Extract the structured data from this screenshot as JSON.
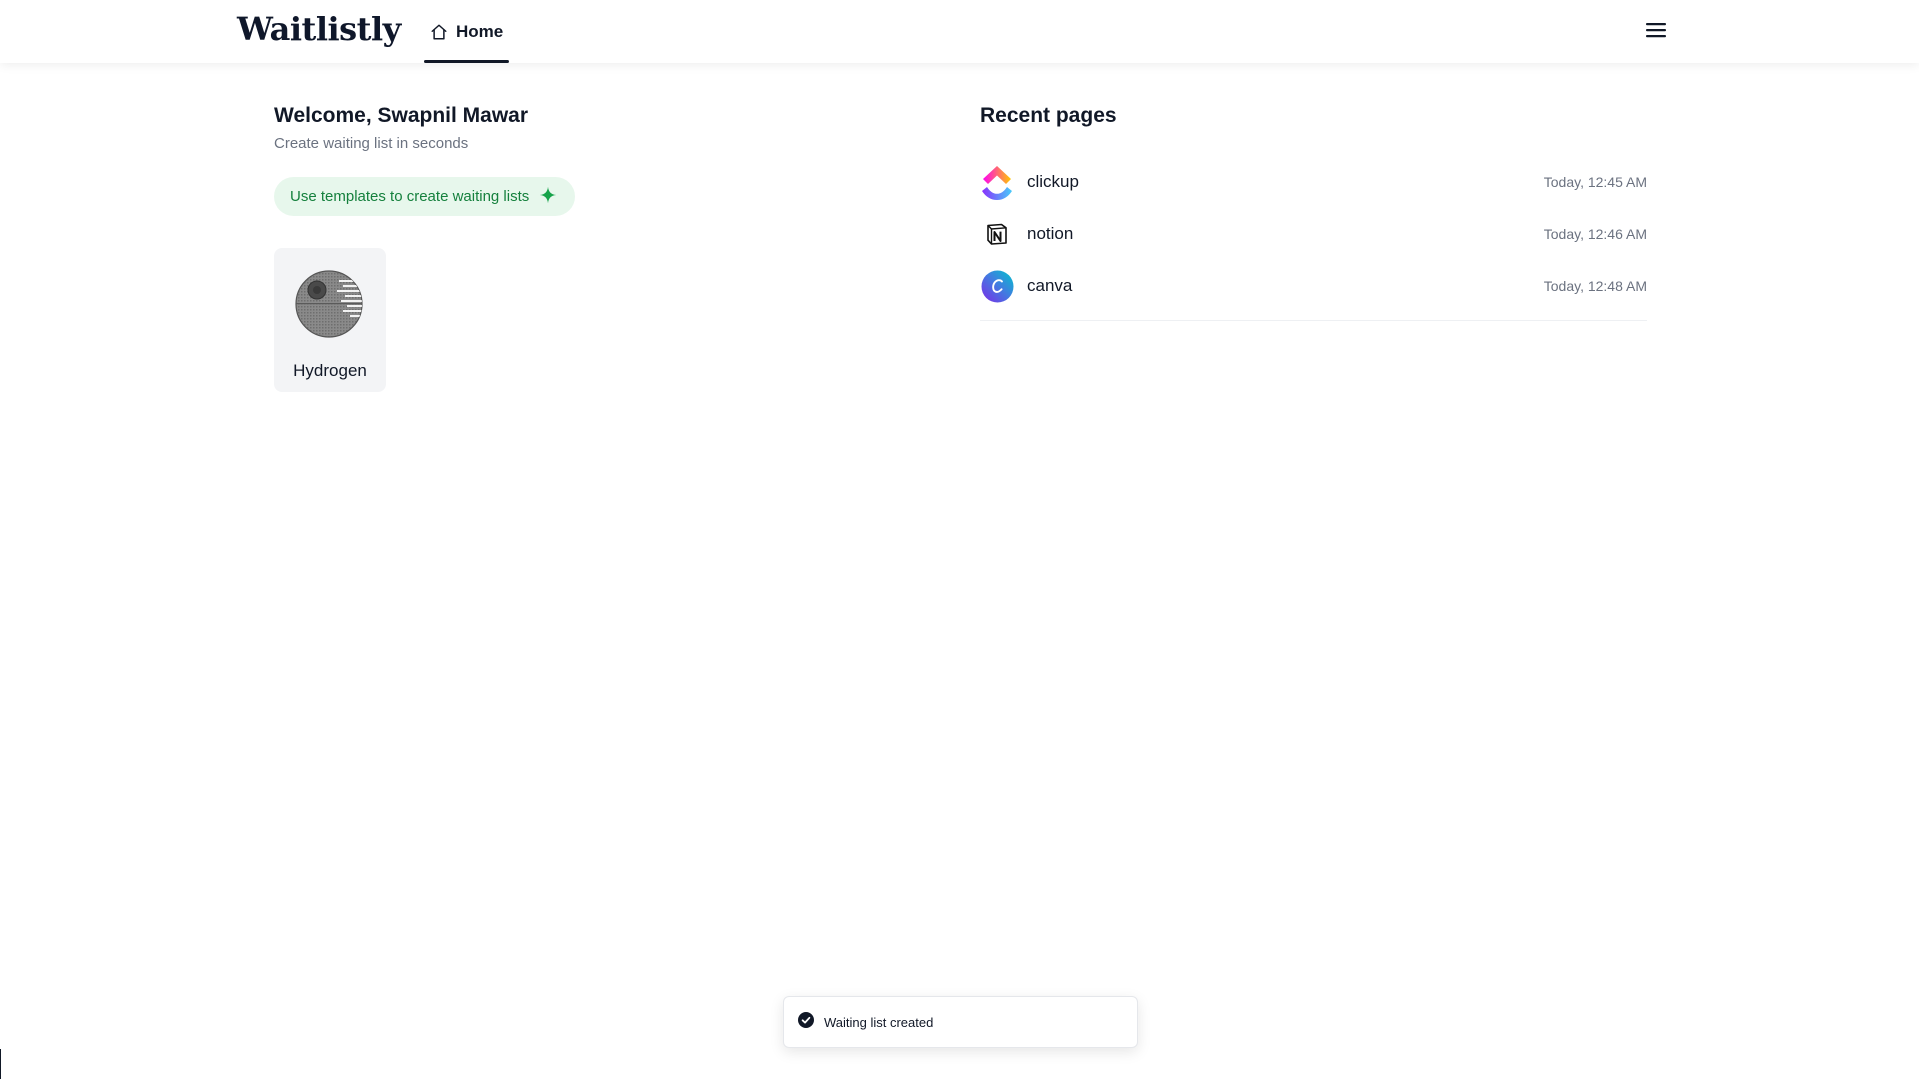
{
  "header": {
    "brand": "Waitlistly",
    "nav": {
      "home_label": "Home",
      "home_icon": "home-icon"
    },
    "menu_icon": "hamburger-menu-icon"
  },
  "welcome": {
    "title": "Welcome, Swapnil Mawar",
    "subtitle": "Create waiting list in seconds",
    "template_button": "Use templates to create waiting lists",
    "template_button_icon": "sparkle-icon"
  },
  "pages": [
    {
      "name": "Hydrogen",
      "icon": "death-star-avatar"
    }
  ],
  "recent": {
    "title": "Recent pages",
    "items": [
      {
        "name": "clickup",
        "time": "Today, 12:45 AM",
        "icon": "clickup-logo"
      },
      {
        "name": "notion",
        "time": "Today, 12:46 AM",
        "icon": "notion-logo"
      },
      {
        "name": "canva",
        "time": "Today, 12:48 AM",
        "icon": "canva-logo"
      }
    ]
  },
  "toast": {
    "message": "Waiting list created",
    "icon": "check-circle-icon"
  },
  "colors": {
    "accent_green": "#15803d",
    "accent_green_bg": "#e7f7ec",
    "text_primary": "#111827",
    "text_muted": "#6b7280"
  }
}
